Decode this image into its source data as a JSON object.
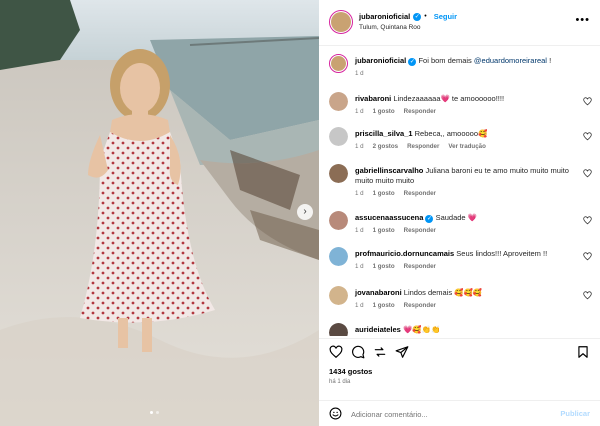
{
  "post": {
    "author": "jubaronioficial",
    "follow_label": "Seguir",
    "location": "Tulum, Quintana Roo",
    "caption": {
      "user": "jubaronioficial",
      "text": "Foi bom demais",
      "mention": "@eduardomoreirareal",
      "tail": "!",
      "age": "1 d"
    },
    "comments": [
      {
        "user": "rivabaroni",
        "text": "Lindezaaaaaa💗 te amoooooo!!!!",
        "age": "1 d",
        "likes": "1 gosto",
        "reply": "Responder",
        "extra": "",
        "avatar_color": "#c9a58a",
        "verified": false
      },
      {
        "user": "priscilla_silva_1",
        "text": "Rebeca,, amooooo🥰",
        "age": "1 d",
        "likes": "2 gostos",
        "reply": "Responder",
        "extra": "Ver tradução",
        "avatar_color": "#c7c7c7",
        "verified": false
      },
      {
        "user": "gabriellinscarvalho",
        "text": "Juliana baroni eu te amo muito muito muito muito muito muito",
        "age": "1 d",
        "likes": "1 gosto",
        "reply": "Responder",
        "extra": "",
        "avatar_color": "#8b6d55",
        "verified": false
      },
      {
        "user": "assucenaassucena",
        "text": "Saudade 💗",
        "age": "1 d",
        "likes": "1 gosto",
        "reply": "Responder",
        "extra": "",
        "avatar_color": "#b88a7a",
        "verified": true
      },
      {
        "user": "profmauricio.dornuncamais",
        "text": "Seus lindos!!! Aproveitem !!",
        "age": "1 d",
        "likes": "1 gosto",
        "reply": "Responder",
        "extra": "",
        "avatar_color": "#7fb3d6",
        "verified": false
      },
      {
        "user": "jovanabaroni",
        "text": "Lindos demais 🥰🥰🥰",
        "age": "1 d",
        "likes": "1 gosto",
        "reply": "Responder",
        "extra": "",
        "avatar_color": "#d2b48c",
        "verified": false
      },
      {
        "user": "aurideiateles",
        "text": "💗🥰👏👏",
        "age": "",
        "likes": "",
        "reply": "",
        "extra": "",
        "avatar_color": "#5a4a42",
        "verified": false
      }
    ],
    "likes_count": "1434 gostos",
    "posted_ago": "há 1 dia",
    "comment_placeholder": "Adicionar comentário...",
    "publish_label": "Publicar"
  },
  "icons": [
    "more-icon",
    "heart-icon",
    "comment-icon",
    "share-icon",
    "send-icon",
    "bookmark-icon",
    "emoji-icon",
    "close-icon",
    "next-arrow-icon"
  ],
  "colors": {
    "accent": "#0095f6",
    "mention": "#00376b",
    "muted": "#737373"
  }
}
